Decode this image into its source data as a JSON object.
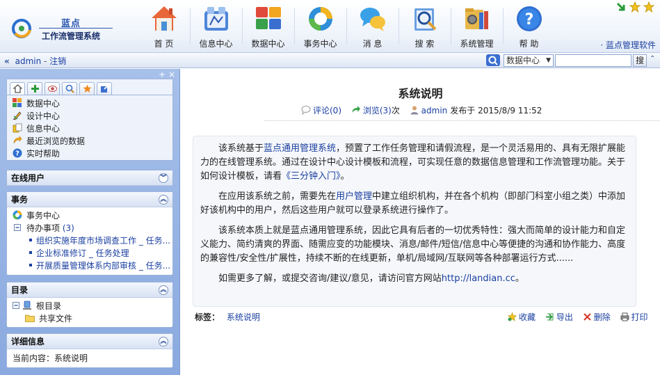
{
  "brand": {
    "short": "蓝点",
    "name": "工作流管理系统"
  },
  "nav": [
    {
      "key": "home",
      "label": "首 页"
    },
    {
      "key": "info",
      "label": "信息中心"
    },
    {
      "key": "data",
      "label": "数据中心"
    },
    {
      "key": "affairs",
      "label": "事务中心"
    },
    {
      "key": "message",
      "label": "消 息"
    },
    {
      "key": "search",
      "label": "搜 索"
    },
    {
      "key": "admin",
      "label": "系统管理"
    },
    {
      "key": "help",
      "label": "帮 助"
    }
  ],
  "product_link": "· 蓝点管理软件",
  "toolbar": {
    "user": "admin",
    "sep": "-",
    "logout": "注销",
    "search_scope": "数据中心",
    "search_value": "",
    "search_button": "搜"
  },
  "sidebar": {
    "quick_items": [
      {
        "icon": "data-grid-icon",
        "label": "数据中心"
      },
      {
        "icon": "pencil-icon",
        "label": "设计中心"
      },
      {
        "icon": "document-icon",
        "label": "信息中心"
      },
      {
        "icon": "recent-arrow-icon",
        "label": "最近浏览的数据"
      },
      {
        "icon": "help-icon",
        "label": "实时帮助"
      }
    ],
    "online_title": "在线用户",
    "affairs_title": "事务",
    "affairs_center": "事务中心",
    "todo_label": "待办事项",
    "todo_count": "(3)",
    "tasks": [
      "组织实施年度市场调查工作 _ 任务...",
      "企业标准修订 _ 任务处理",
      "开展质量管理体系内部审核 _ 任务..."
    ],
    "dir_title": "目录",
    "dir_root": "根目录",
    "dir_shared": "共享文件",
    "detail_title": "详细信息",
    "detail_text": "当前内容：系统说明"
  },
  "article": {
    "title": "系统说明",
    "comment_link": "评论(0)",
    "views_link": "浏览(3)",
    "views_unit": "次",
    "author": "admin",
    "published": "发布于 2015/8/9 11:52",
    "p1_pre": "该系统基于",
    "p1_link": "蓝点通用管理系统",
    "p1_mid": "，预置了工作任务管理和请假流程，是一个灵活易用的、具有无限扩展能力的在线管理系统。通过在设计中心设计模板和流程，可实现任意的数据信息管理和工作流管理功能。关于如何设计模板，请看",
    "p1_link2": "《三分钟入门》",
    "p1_end": "。",
    "p2_pre": "在应用该系统之前，需要先在",
    "p2_link": "用户管理",
    "p2_end": "中建立组织机构，并在各个机构（即部门科室小组之类）中添加好该机构中的用户，然后这些用户就可以登录系统进行操作了。",
    "p3": "该系统本质上就是蓝点通用管理系统，因此它具有后者的一切优秀特性：强大而简单的设计能力和自定义能力、简约清爽的界面、随需应变的功能模块、消息/邮件/短信/信息中心等便捷的沟通和协作能力、高度的兼容性/安全性/扩展性，持续不断的在线更新，单机/局域网/互联网等各种部署运行方式......",
    "p4_pre": "如需更多了解，或提交咨询/建议/意见，请访问官方网站",
    "p4_link": "http://landian.cc",
    "p4_end": "。",
    "tag_label": "标签：",
    "tag_value": "系统说明",
    "actions": {
      "favorite": "收藏",
      "export": "导出",
      "delete": "删除",
      "print": "打印"
    }
  }
}
